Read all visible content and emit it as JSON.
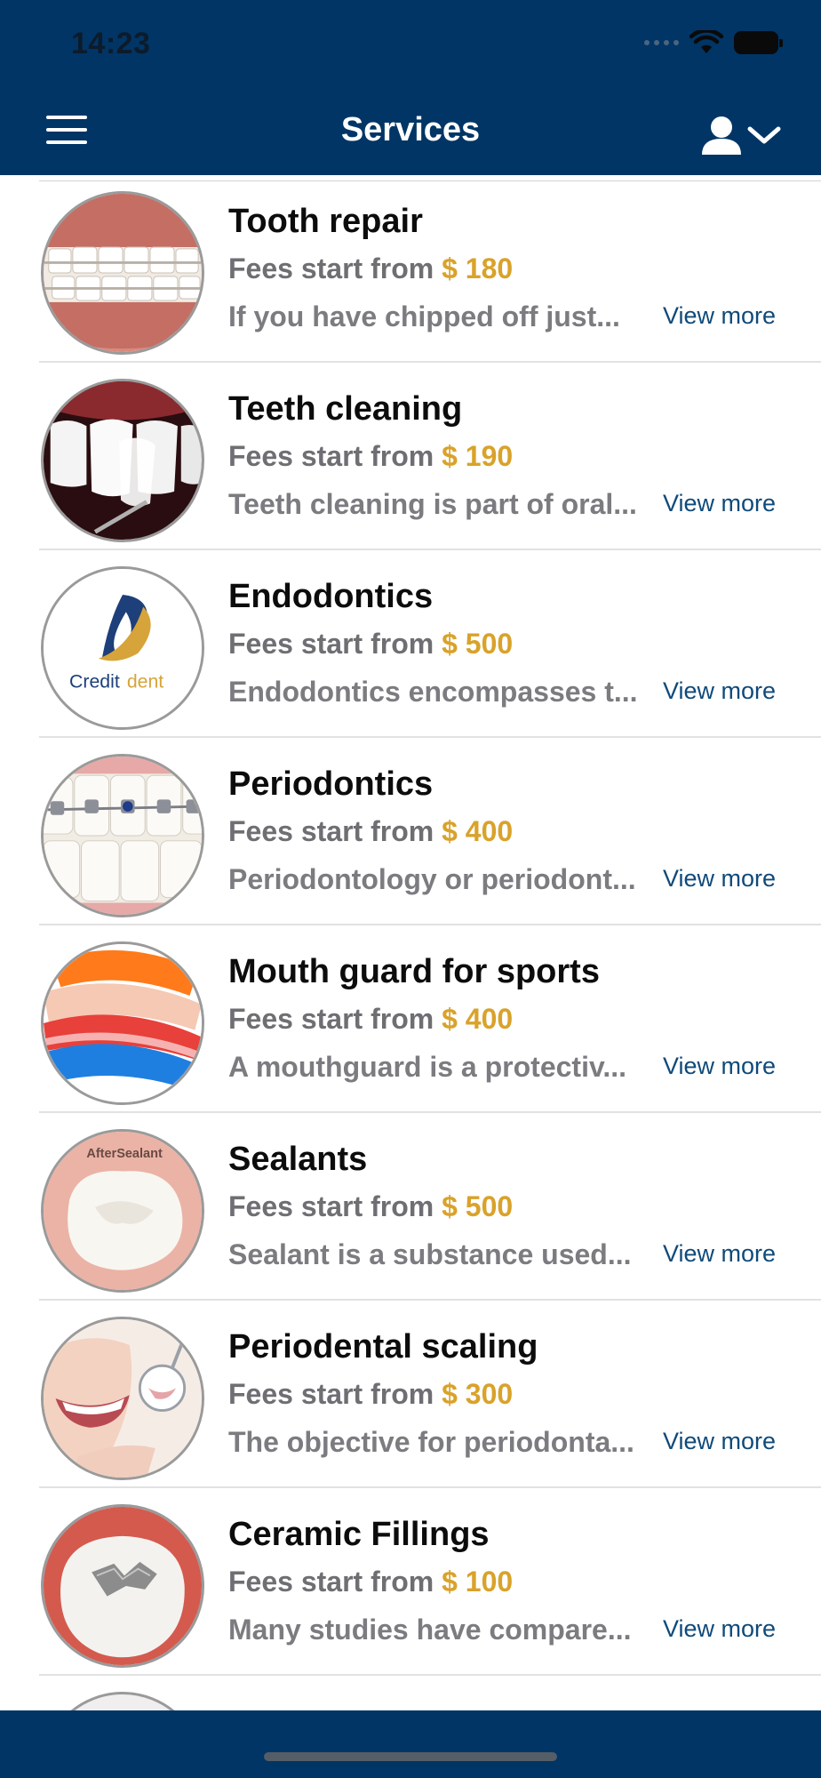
{
  "status_bar": {
    "time": "14:23"
  },
  "header": {
    "title": "Services",
    "menu_icon": "hamburger-menu-icon",
    "user_icon": "user-dropdown-icon"
  },
  "services": [
    {
      "name": "Tooth repair",
      "fee_label": "Fees start from",
      "price": "$ 180",
      "description": "If you have chipped off just...",
      "view_more": "View more",
      "image": "braces-smile-image"
    },
    {
      "name": "Teeth cleaning",
      "fee_label": "Fees start from",
      "price": "$ 190",
      "description": "Teeth cleaning is part of oral...",
      "view_more": "View more",
      "image": "veneer-teeth-image"
    },
    {
      "name": "Endodontics",
      "fee_label": "Fees start from",
      "price": "$ 500",
      "description": "Endodontics encompasses t...",
      "view_more": "View more",
      "image": "creditdent-logo",
      "logo_text_a": "Credit",
      "logo_text_b": "dent"
    },
    {
      "name": "Periodontics",
      "fee_label": "Fees start from",
      "price": "$ 400",
      "description": "Periodontology or periodont...",
      "view_more": "View more",
      "image": "metal-braces-image"
    },
    {
      "name": "Mouth guard for sports",
      "fee_label": "Fees start from",
      "price": "$ 400",
      "description": "A mouthguard is a protectiv...",
      "view_more": "View more",
      "image": "mouthguards-image"
    },
    {
      "name": "Sealants",
      "fee_label": "Fees start from",
      "price": "$ 500",
      "description": "Sealant is a substance used...",
      "view_more": "View more",
      "image": "sealant-molar-image",
      "image_caption": "AfterSealant"
    },
    {
      "name": "Periodental scaling",
      "fee_label": "Fees start from",
      "price": "$ 300",
      "description": "The objective for periodonta...",
      "view_more": "View more",
      "image": "smile-mirror-image"
    },
    {
      "name": "Ceramic Fillings",
      "fee_label": "Fees start from",
      "price": "$ 100",
      "description": "Many studies have compare...",
      "view_more": "View more",
      "image": "ceramic-filling-image"
    }
  ],
  "colors": {
    "header_bg": "#003566",
    "price": "#d9a22a",
    "link": "#0f4a7a"
  }
}
